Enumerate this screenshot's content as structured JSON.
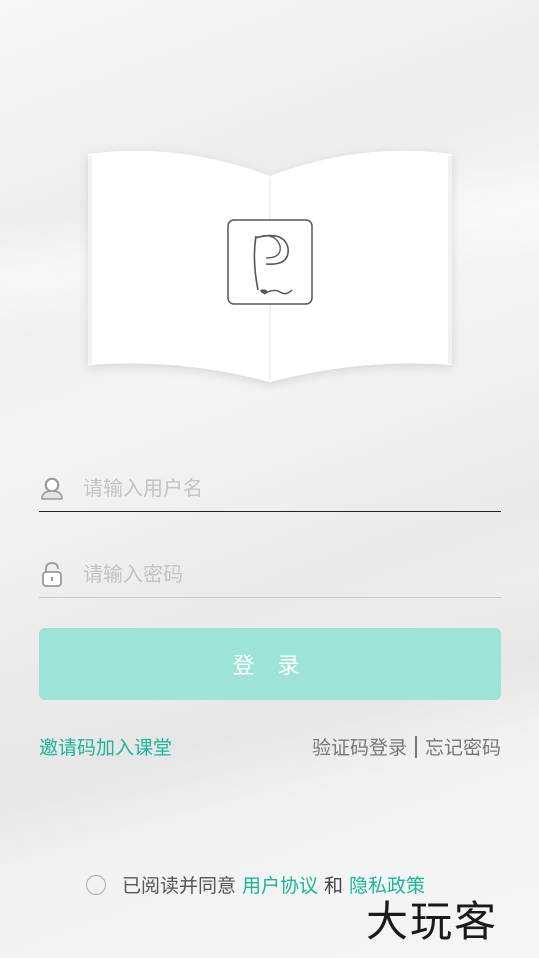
{
  "login": {
    "username_placeholder": "请输入用户名",
    "password_placeholder": "请输入密码",
    "login_button": "登 录"
  },
  "links": {
    "invite_code": "邀请码加入课堂",
    "sms_login": "验证码登录",
    "forgot_password": "忘记密码"
  },
  "agreement": {
    "prefix": "已阅读并同意",
    "user_agreement": "用户协议",
    "and": "和",
    "privacy_policy": "隐私政策",
    "checked": false
  },
  "watermark": "大玩客",
  "colors": {
    "accent": "#1ab59d",
    "button": "#9de3d7"
  },
  "icons": {
    "logo": "p-logo-icon",
    "user": "user-icon",
    "lock": "lock-icon"
  }
}
